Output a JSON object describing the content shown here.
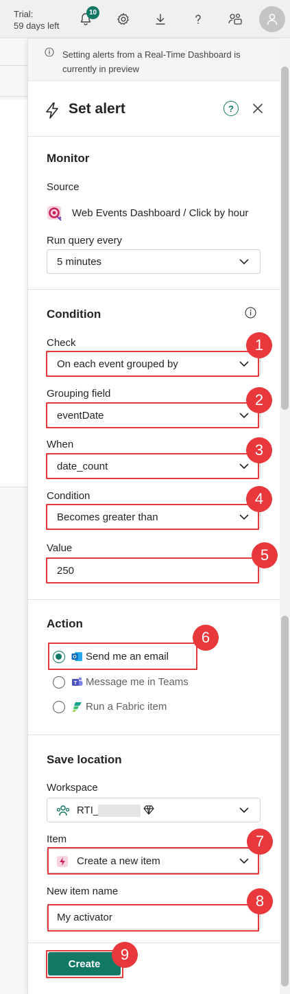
{
  "topbar": {
    "trial_line1": "Trial:",
    "trial_line2": "59 days left",
    "notifications_count": "10",
    "icons": [
      "bell-icon",
      "gear-icon",
      "download-icon",
      "help-icon",
      "share-people-icon",
      "user-avatar-icon"
    ]
  },
  "banner": {
    "text": "Setting alerts from a Real-Time Dashboard is currently in preview"
  },
  "header": {
    "title": "Set alert",
    "help": "?"
  },
  "monitor": {
    "title": "Monitor",
    "source_label": "Source",
    "source_value": "Web Events Dashboard / Click by hour",
    "run_label": "Run query every",
    "run_value": "5 minutes"
  },
  "condition": {
    "title": "Condition",
    "check_label": "Check",
    "check_value": "On each event grouped by",
    "grouping_label": "Grouping field",
    "grouping_value": "eventDate",
    "when_label": "When",
    "when_value": "date_count",
    "condition_label": "Condition",
    "condition_value": "Becomes greater than",
    "value_label": "Value",
    "value_value": "250"
  },
  "action": {
    "title": "Action",
    "options": [
      {
        "label": "Send me an email",
        "selected": true
      },
      {
        "label": "Message me in Teams",
        "selected": false
      },
      {
        "label": "Run a Fabric item",
        "selected": false
      }
    ]
  },
  "save": {
    "title": "Save location",
    "workspace_label": "Workspace",
    "workspace_value": "RTI_",
    "item_label": "Item",
    "item_value": "Create a new item",
    "name_label": "New item name",
    "name_value": "My activator"
  },
  "footer": {
    "create_label": "Create"
  },
  "callouts": [
    "1",
    "2",
    "3",
    "4",
    "5",
    "6",
    "7",
    "8",
    "9"
  ],
  "colors": {
    "accent": "#117865",
    "callout": "#e8383c"
  }
}
